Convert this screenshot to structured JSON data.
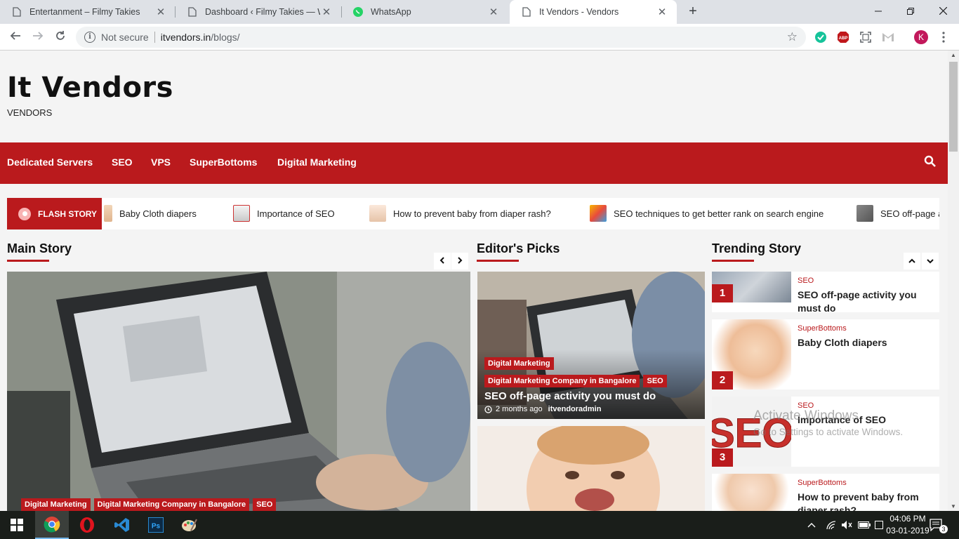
{
  "browser": {
    "tabs": [
      {
        "title": "Entertanment – Filmy Takies"
      },
      {
        "title": "Dashboard ‹ Filmy Takies — Word"
      },
      {
        "title": "WhatsApp"
      },
      {
        "title": "It Vendors - Vendors"
      }
    ],
    "close_glyph": "✕",
    "new_tab_glyph": "+",
    "omnibox": {
      "security_text": "Not secure",
      "url_host": "itvendors.in",
      "url_path": "/blogs/"
    },
    "profile_initial": "K"
  },
  "site": {
    "title": "It Vendors",
    "tagline": "VENDORS",
    "nav": [
      "Dedicated Servers",
      "SEO",
      "VPS",
      "SuperBottoms",
      "Digital Marketing"
    ]
  },
  "flash": {
    "label": "FLASH STORY",
    "items": [
      "Baby Cloth diapers",
      "Importance of SEO",
      "How to prevent baby from diaper rash?",
      "SEO techniques to get better rank on search engine",
      "SEO off-page ac"
    ]
  },
  "sections": {
    "main": "Main Story",
    "editors": "Editor's Picks",
    "trending": "Trending Story"
  },
  "main_story": {
    "tags": [
      "Digital Marketing",
      "Digital Marketing Company in Bangalore",
      "SEO"
    ]
  },
  "editors_picks": [
    {
      "tags_row1": [
        "Digital Marketing"
      ],
      "tags_row2": [
        "Digital Marketing Company in Bangalore",
        "SEO"
      ],
      "title": "SEO off-page activity you must do",
      "time": "2 months ago",
      "author": "itvendoradmin"
    }
  ],
  "trending": [
    {
      "num": "1",
      "category": "SEO",
      "title": "SEO off-page activity you must do"
    },
    {
      "num": "2",
      "category": "SuperBottoms",
      "title": "Baby Cloth diapers"
    },
    {
      "num": "3",
      "category": "SEO",
      "title": "Importance of SEO"
    },
    {
      "num": "",
      "category": "SuperBottoms",
      "title": "How to prevent baby from diaper rash?"
    }
  ],
  "watermark": {
    "line1": "Activate Windows",
    "line2": "Go to Settings to activate Windows."
  },
  "taskbar": {
    "time": "04:06 PM",
    "date": "03-01-2019",
    "notification_count": "3"
  },
  "colors": {
    "brand_red": "#ba1a1d",
    "chrome_bg": "#dee1e6",
    "taskbar_bg": "#1a1e1a"
  }
}
